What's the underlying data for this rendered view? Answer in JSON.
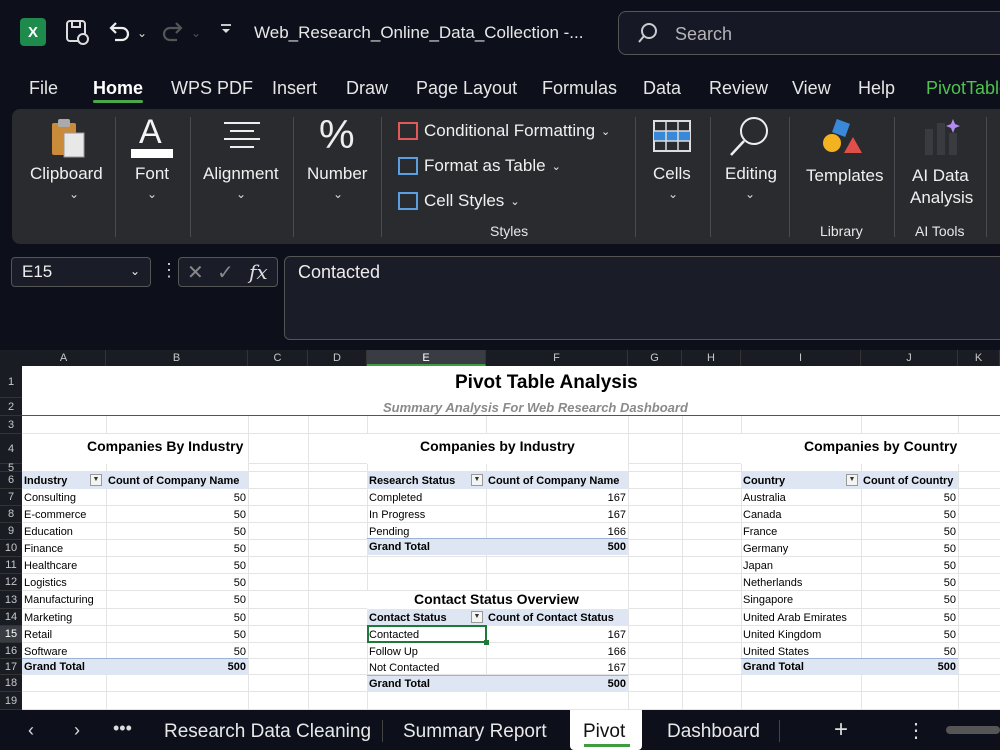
{
  "app": {
    "logo_letter": "X",
    "window_title": "Web_Research_Online_Data_Collection  -...",
    "search_placeholder": "Search"
  },
  "menu": [
    "File",
    "Home",
    "WPS PDF",
    "Insert",
    "Draw",
    "Page Layout",
    "Formulas",
    "Data",
    "Review",
    "View",
    "Help",
    "PivotTable"
  ],
  "ribbon": {
    "clipboard": "Clipboard",
    "font": "Font",
    "alignment": "Alignment",
    "number": "Number",
    "conditional_formatting": "Conditional Formatting",
    "format_as_table": "Format as Table",
    "cell_styles": "Cell Styles",
    "styles_group": "Styles",
    "cells": "Cells",
    "editing": "Editing",
    "templates": "Templates",
    "library_group": "Library",
    "ai_data_analysis_1": "AI Data",
    "ai_data_analysis_2": "Analysis",
    "ai_tools_group": "AI Tools"
  },
  "formula_bar": {
    "name_box": "E15",
    "fx": "fx",
    "content": "Contacted"
  },
  "columns": [
    "A",
    "B",
    "C",
    "D",
    "E",
    "F",
    "G",
    "H",
    "I",
    "J",
    "K"
  ],
  "rows": [
    "1",
    "2",
    "3",
    "4",
    "5",
    "6",
    "7",
    "8",
    "9",
    "10",
    "11",
    "12",
    "13",
    "14",
    "15",
    "16",
    "17",
    "18",
    "19"
  ],
  "sheet": {
    "title": "Pivot Table Analysis",
    "subtitle": "Summary Analysis For Web Research Dashboard",
    "industry_table": {
      "heading": "Companies By Industry",
      "col1": "Industry",
      "col2": "Count of Company Name",
      "rows": [
        [
          "Consulting",
          "50"
        ],
        [
          "E-commerce",
          "50"
        ],
        [
          "Education",
          "50"
        ],
        [
          "Finance",
          "50"
        ],
        [
          "Healthcare",
          "50"
        ],
        [
          "Logistics",
          "50"
        ],
        [
          "Manufacturing",
          "50"
        ],
        [
          "Marketing",
          "50"
        ],
        [
          "Retail",
          "50"
        ],
        [
          "Software",
          "50"
        ]
      ],
      "total_label": "Grand Total",
      "total_value": "500"
    },
    "status_table": {
      "heading": "Companies by Industry",
      "col1": "Research Status",
      "col2": "Count of Company Name",
      "rows": [
        [
          "Completed",
          "167"
        ],
        [
          "In Progress",
          "167"
        ],
        [
          "Pending",
          "166"
        ]
      ],
      "total_label": "Grand Total",
      "total_value": "500"
    },
    "contact_table": {
      "heading": "Contact Status Overview",
      "col1": "Contact Status",
      "col2": "Count of Contact Status",
      "rows": [
        [
          "Contacted",
          "167"
        ],
        [
          "Follow Up",
          "166"
        ],
        [
          "Not Contacted",
          "167"
        ]
      ],
      "total_label": "Grand Total",
      "total_value": "500"
    },
    "country_table": {
      "heading": "Companies by Country",
      "col1": "Country",
      "col2": "Count of Country",
      "rows": [
        [
          "Australia",
          "50"
        ],
        [
          "Canada",
          "50"
        ],
        [
          "France",
          "50"
        ],
        [
          "Germany",
          "50"
        ],
        [
          "Japan",
          "50"
        ],
        [
          "Netherlands",
          "50"
        ],
        [
          "Singapore",
          "50"
        ],
        [
          "United Arab Emirates",
          "50"
        ],
        [
          "United Kingdom",
          "50"
        ],
        [
          "United States",
          "50"
        ]
      ],
      "total_label": "Grand Total",
      "total_value": "500"
    }
  },
  "sheet_tabs": [
    "Research Data Cleaning",
    "Summary Report",
    "Pivot",
    "Dashboard"
  ],
  "active_sheet": "Pivot",
  "colors": {
    "accent_green": "#3f9d3f",
    "header_band": "#dde6f2"
  }
}
